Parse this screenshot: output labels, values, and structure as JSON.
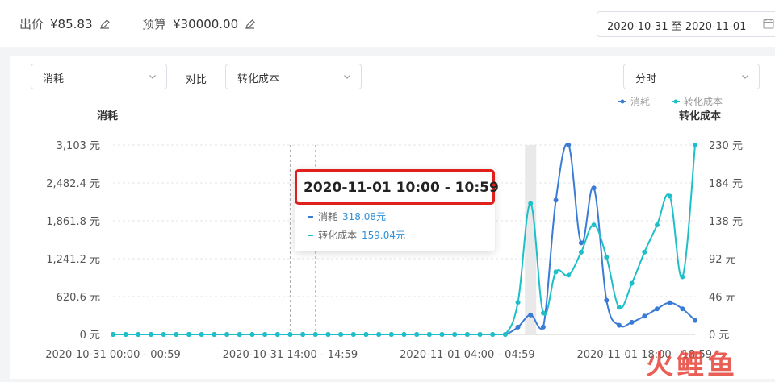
{
  "header": {
    "bid_label": "出价",
    "bid_value": "¥85.83",
    "budget_label": "预算",
    "budget_value": "¥30000.00",
    "date_range": "2020-10-31 至 2020-11-01"
  },
  "controls": {
    "metric_select": "消耗",
    "compare_label": "对比",
    "compare_select": "转化成本",
    "granularity_select": "分时"
  },
  "tooltip": {
    "title": "2020-11-01 10:00 - 10:59",
    "rows": [
      {
        "name": "消耗",
        "value": "318.08元"
      },
      {
        "name": "转化成本",
        "value": "159.04元"
      }
    ]
  },
  "watermark": "火鲤鱼",
  "colors": {
    "series1": "#3a7bd5",
    "series2": "#1fbfc8",
    "highlight_border": "#e0201b"
  },
  "chart_data": {
    "type": "line",
    "left_axis_title": "消耗",
    "right_axis_title": "转化成本",
    "left_ticks": [
      "3,103 元",
      "2,482.4 元",
      "1,861.8 元",
      "1,241.2 元",
      "620.6 元",
      "0 元"
    ],
    "right_ticks": [
      "230 元",
      "184 元",
      "138 元",
      "92 元",
      "46 元",
      "0 元"
    ],
    "ylim_left": [
      0,
      3103
    ],
    "ylim_right": [
      0,
      230
    ],
    "x_tick_labels": [
      "2020-10-31 00:00 - 00:59",
      "2020-10-31 14:00 - 14:59",
      "2020-11-01 04:00 - 04:59",
      "2020-11-01 18:00 - 18:59"
    ],
    "legend": [
      "消耗",
      "转化成本"
    ],
    "legend_position": "top-right",
    "grid": true,
    "series": [
      {
        "name": "消耗",
        "axis": "left",
        "values": [
          0,
          0,
          0,
          0,
          0,
          0,
          0,
          0,
          0,
          0,
          0,
          0,
          0,
          0,
          0,
          0,
          0,
          0,
          0,
          0,
          0,
          0,
          0,
          0,
          0,
          0,
          0,
          0,
          0,
          0,
          0,
          0,
          120,
          318,
          120,
          2200,
          3103,
          1500,
          2400,
          560,
          150,
          200,
          300,
          420,
          520,
          420,
          230
        ]
      },
      {
        "name": "转化成本",
        "axis": "right",
        "values": [
          0,
          0,
          0,
          0,
          0,
          0,
          0,
          0,
          0,
          0,
          0,
          0,
          0,
          0,
          0,
          0,
          0,
          0,
          0,
          0,
          0,
          0,
          0,
          0,
          0,
          0,
          0,
          0,
          0,
          0,
          0,
          0,
          39,
          159,
          26,
          76,
          72,
          100,
          133,
          94,
          33,
          62,
          100,
          133,
          168,
          70,
          230
        ]
      }
    ]
  }
}
